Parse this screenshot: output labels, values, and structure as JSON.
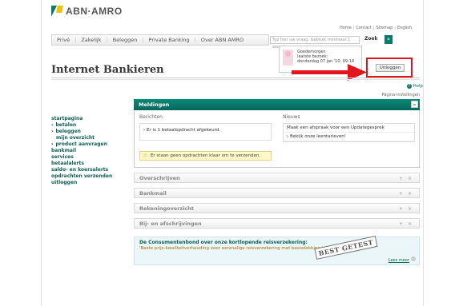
{
  "brand": {
    "name": "ABN·AMRO"
  },
  "top_links": [
    "Home",
    "Contact",
    "Sitemap",
    "English"
  ],
  "main_nav": [
    "Privé",
    "Zakelijk",
    "Beleggen",
    "Private Banking",
    "Over ABN AMRO"
  ],
  "search": {
    "placeholder": "Typ hier uw vraag. Gebruik minimaal 2 woorden.",
    "button": "Zoek",
    "go": "»"
  },
  "page_title": "Internet Bankieren",
  "greeting": {
    "line1": "Goedemorgen",
    "line2": "laatste bezoek:",
    "line3": "donderdag 07 jan '10, 09:14"
  },
  "logout_label": "Uitloggen",
  "help_label": "Help",
  "page_settings_label": "Pagina-instellingen",
  "sidebar": [
    {
      "label": "startpagina",
      "arrow": false,
      "sub": false
    },
    {
      "label": "betalen",
      "arrow": true,
      "sub": false
    },
    {
      "label": "beleggen",
      "arrow": true,
      "sub": false
    },
    {
      "label": "mijn overzicht",
      "arrow": false,
      "sub": true
    },
    {
      "label": "product aanvragen",
      "arrow": true,
      "sub": false
    },
    {
      "label": "bankmail",
      "arrow": false,
      "sub": false
    },
    {
      "label": "services",
      "arrow": false,
      "sub": false
    },
    {
      "label": "betaalalerts",
      "arrow": false,
      "sub": false
    },
    {
      "label": "saldo- en koersalerts",
      "arrow": false,
      "sub": false
    },
    {
      "label": "opdrachten verzenden",
      "arrow": false,
      "sub": false
    },
    {
      "label": "uitloggen",
      "arrow": false,
      "sub": false
    }
  ],
  "meldingen": {
    "title": "Meldingen",
    "berichten_label": "Berichten",
    "message": "Er is 1 betaalopdracht afgekeurd.",
    "warning": "Er staan geen opdrachten klaar om te verzenden.",
    "nieuws_label": "Nieuws",
    "news": [
      "Maak een afspraak voor een Updategesprek",
      "Bekijk onze leentarieven!"
    ]
  },
  "panels": [
    "Overschrijven",
    "Bankmail",
    "Rekeningoverzicht",
    "Bij- en afschrijvingen"
  ],
  "promo": {
    "title": "De Consumentenbond over onze kortlopende reisverzekering:",
    "subtitle": "'Beste prijs-kwaliteitverhouding voor eenmalige reisverzekering met basisdekking.'",
    "stamp": "BEST GETEST",
    "link": "Lees meer"
  },
  "colors": {
    "accent": "#0a7a6b",
    "highlight": "#e2141e"
  }
}
